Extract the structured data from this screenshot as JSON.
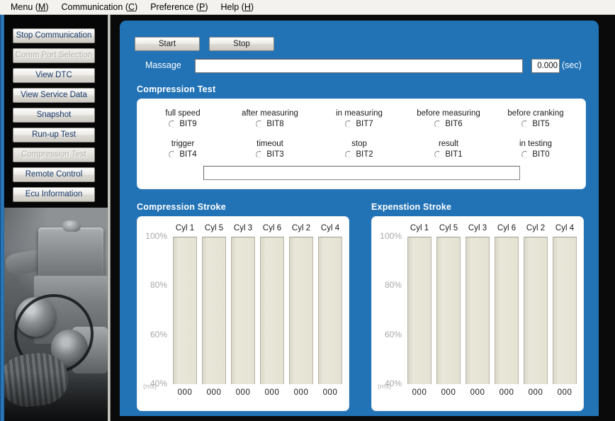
{
  "menubar": {
    "items": [
      {
        "label": "Menu (M)",
        "text": "Menu (",
        "acc": "M",
        "tail": ")"
      },
      {
        "label": "Communication (C)",
        "text": "Communication (",
        "acc": "C",
        "tail": ")"
      },
      {
        "label": "Preference (P)",
        "text": "Preference (",
        "acc": "P",
        "tail": ")"
      },
      {
        "label": "Help (H)",
        "text": "Help (",
        "acc": "H",
        "tail": ")"
      }
    ]
  },
  "sidebar": {
    "items": [
      {
        "label": "Stop Communication",
        "disabled": false
      },
      {
        "label": "Comm Port Selection",
        "disabled": true
      },
      {
        "label": "View DTC",
        "disabled": false
      },
      {
        "label": "View Service Data",
        "disabled": false
      },
      {
        "label": "Snapshot",
        "disabled": false
      },
      {
        "label": "Run-up Test",
        "disabled": false
      },
      {
        "label": "Compression Test",
        "disabled": true
      },
      {
        "label": "Remote Control",
        "disabled": false
      },
      {
        "label": "Ecu Information",
        "disabled": false
      }
    ],
    "photo_alt": "engine-photo"
  },
  "toolbar": {
    "start_label": "Start",
    "stop_label": "Stop"
  },
  "massage": {
    "label": "Massage",
    "value": "",
    "placeholder": "",
    "seconds_value": "0.000",
    "seconds_unit": "(sec)"
  },
  "compression_test": {
    "title": "Compression Test",
    "flags": [
      {
        "caption": "full speed",
        "bit": "BIT9",
        "checked": false
      },
      {
        "caption": "after measuring",
        "bit": "BIT8",
        "checked": false
      },
      {
        "caption": "in measuring",
        "bit": "BIT7",
        "checked": false
      },
      {
        "caption": "before measuring",
        "bit": "BIT6",
        "checked": false
      },
      {
        "caption": "before cranking",
        "bit": "BIT5",
        "checked": false
      },
      {
        "caption": "trigger",
        "bit": "BIT4",
        "checked": false
      },
      {
        "caption": "timeout",
        "bit": "BIT3",
        "checked": false
      },
      {
        "caption": "stop",
        "bit": "BIT2",
        "checked": false
      },
      {
        "caption": "result",
        "bit": "BIT1",
        "checked": false
      },
      {
        "caption": "in testing",
        "bit": "BIT0",
        "checked": false
      }
    ],
    "status_field_value": "",
    "status_field_placeholder": ""
  },
  "colors": {
    "panel_blue": "#2273b6",
    "bar_fill": "#e4e2d2",
    "button_face": "#ece9e4",
    "button_text": "#16386a",
    "axis_text": "#a8a8a8"
  },
  "chart_data": [
    {
      "type": "bar",
      "title": "Compression Stroke",
      "categories": [
        "Cyl 1",
        "Cyl 5",
        "Cyl 3",
        "Cyl 6",
        "Cyl 2",
        "Cyl 4"
      ],
      "values": [
        100,
        100,
        100,
        100,
        100,
        100
      ],
      "data_labels": [
        "000",
        "000",
        "000",
        "000",
        "000",
        "000"
      ],
      "ytick_labels": [
        "100%",
        "80%",
        "60%",
        "40%"
      ],
      "yticks": [
        100,
        80,
        60,
        40
      ],
      "ylim": [
        40,
        100
      ],
      "xlabel": "",
      "ylabel": "(ms)",
      "grid": false,
      "legend": "none"
    },
    {
      "type": "bar",
      "title": "Expenstion Stroke",
      "categories": [
        "Cyl 1",
        "Cyl 5",
        "Cyl 3",
        "Cyl 6",
        "Cyl 2",
        "Cyl 4"
      ],
      "values": [
        100,
        100,
        100,
        100,
        100,
        100
      ],
      "data_labels": [
        "000",
        "000",
        "000",
        "000",
        "000",
        "000"
      ],
      "ytick_labels": [
        "100%",
        "80%",
        "60%",
        "40%"
      ],
      "yticks": [
        100,
        80,
        60,
        40
      ],
      "ylim": [
        40,
        100
      ],
      "xlabel": "",
      "ylabel": "(ms)",
      "grid": false,
      "legend": "none"
    }
  ]
}
